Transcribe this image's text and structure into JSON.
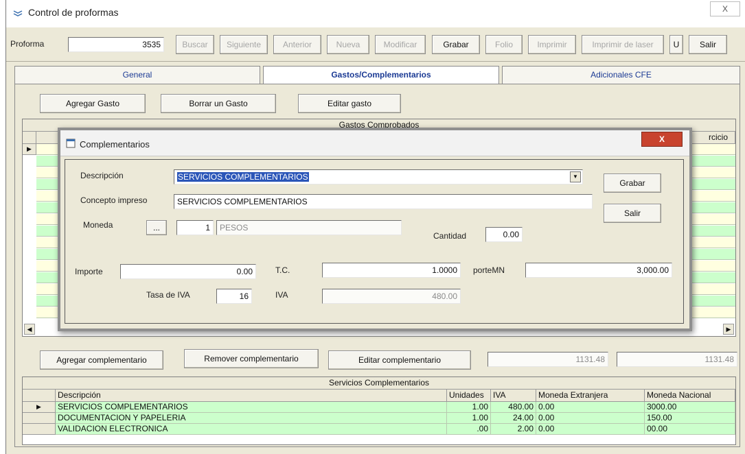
{
  "window": {
    "title": "Control de proformas",
    "close_label": "X"
  },
  "toolbar": {
    "proforma_label": "Proforma",
    "proforma_value": "3535",
    "buttons": [
      {
        "label": "Buscar",
        "enabled": false
      },
      {
        "label": "Siguiente",
        "enabled": false
      },
      {
        "label": "Anterior",
        "enabled": false
      },
      {
        "label": "Nueva",
        "enabled": false
      },
      {
        "label": "Modificar",
        "enabled": false
      },
      {
        "label": "Grabar",
        "enabled": true
      },
      {
        "label": "Folio",
        "enabled": false
      },
      {
        "label": "Imprimir",
        "enabled": false
      },
      {
        "label": "Imprimir de laser",
        "enabled": false
      },
      {
        "label": "U",
        "enabled": true
      },
      {
        "label": "Salir",
        "enabled": true
      }
    ]
  },
  "tabs": [
    {
      "label": "General",
      "active": false
    },
    {
      "label": "Gastos/Complementarios",
      "active": true
    },
    {
      "label": "Adicionales CFE",
      "active": false
    }
  ],
  "gastos": {
    "add_label": "Agregar Gasto",
    "remove_label": "Borrar un Gasto",
    "edit_label": "Editar gasto",
    "grid_title": "Gastos Comprobados",
    "partial_header": "rcicio"
  },
  "complementarios": {
    "add_label": "Agregar complementario",
    "remove_label": "Remover complementario",
    "edit_label": "Editar complementario",
    "total1": "1131.48",
    "total2": "1131.48",
    "grid_title": "Servicios Complementarios",
    "columns": [
      "Descripción",
      "Unidades",
      "IVA",
      "Moneda Extranjera",
      "Moneda Nacional"
    ],
    "rows": [
      [
        "SERVICIOS COMPLEMENTARIOS",
        "1.00",
        "480.00",
        "0.00",
        "3000.00"
      ],
      [
        "DOCUMENTACION Y PAPELERIA",
        "1.00",
        "24.00",
        "0.00",
        "150.00"
      ],
      [
        "VALIDACION ELECTRONICA",
        ".00",
        "2.00",
        "0.00",
        "00.00"
      ]
    ]
  },
  "dialog": {
    "title": "Complementarios",
    "close_label": "X",
    "descripcion_label": "Descripción",
    "descripcion_value": "SERVICIOS COMPLEMENTARIOS",
    "concepto_label": "Concepto impreso",
    "concepto_value": "SERVICIOS COMPLEMENTARIOS",
    "moneda_label": "Moneda",
    "moneda_button": "...",
    "moneda_code": "1",
    "moneda_name": "PESOS",
    "cantidad_label": "Cantidad",
    "cantidad_value": "0.00",
    "importe_label": "Importe",
    "importe_value": "0.00",
    "tc_label": "T.C.",
    "tc_value": "1.0000",
    "importe_mn_label": "porteMN",
    "importe_mn_value": "3,000.00",
    "tasa_iva_label": "Tasa de IVA",
    "tasa_iva_value": "16",
    "iva_label": "IVA",
    "iva_value": "480.00",
    "grabar_label": "Grabar",
    "salir_label": "Salir"
  },
  "colors": {
    "row_green": "#ccffcc",
    "row_yellow": "#ffffe0",
    "selection": "#2a55b8",
    "tab_text": "#1b3a94"
  }
}
